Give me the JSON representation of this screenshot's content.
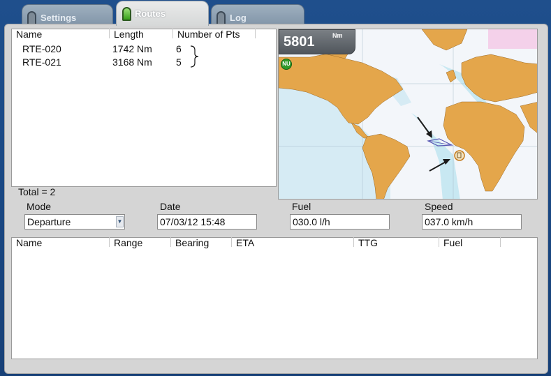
{
  "tabs": [
    {
      "label": "Settings",
      "active": false
    },
    {
      "label": "Routes",
      "active": true
    },
    {
      "label": "Log",
      "active": false
    }
  ],
  "routes_list": {
    "columns": [
      "Name",
      "Length",
      "Number of Pts"
    ],
    "rows": [
      {
        "name": "RTE-020",
        "length": "1742 Nm",
        "points": "6"
      },
      {
        "name": "RTE-021",
        "length": "3168 Nm",
        "points": "5"
      }
    ]
  },
  "total_label": "Total = 2",
  "map": {
    "distance_value": "5801",
    "distance_unit": "Nm",
    "nu_icon_label": "NU"
  },
  "form": {
    "mode": {
      "label": "Mode",
      "value": "Departure"
    },
    "date": {
      "label": "Date",
      "value": "07/03/12 15:48"
    },
    "fuel": {
      "label": "Fuel",
      "value": "030.0 l/h"
    },
    "speed": {
      "label": "Speed",
      "value": "037.0 km/h"
    }
  },
  "waypoints_table": {
    "columns": [
      "Name",
      "Range",
      "Bearing",
      "ETA",
      "TTG",
      "Fuel"
    ]
  },
  "colors": {
    "background_blue": "#1f4f8c",
    "active_led_green": "#36a018",
    "land": "#e4a64b",
    "shallow_water": "#b5e2ee",
    "route_line": "#5a5ab5"
  }
}
